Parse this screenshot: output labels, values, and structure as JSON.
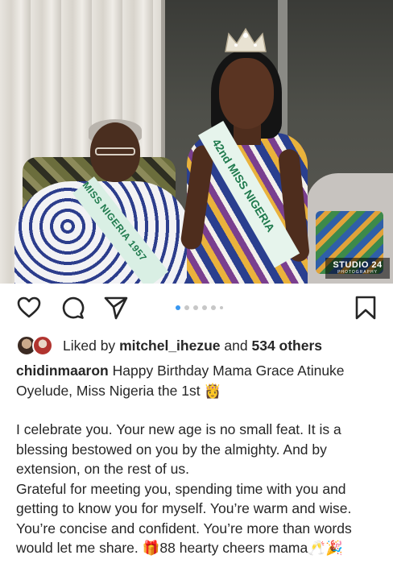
{
  "post": {
    "image_alt": "Two women wearing pageant sashes, one older seated woman and one young woman wearing a crown",
    "sash_left_text": "MISS NIGERIA 1957",
    "sash_right_text": "42nd MISS NIGERIA",
    "watermark": {
      "name": "STUDIO 24",
      "sub": "PHOTOGRAPHY"
    }
  },
  "actions": {
    "icons": [
      "heart-icon",
      "comment-icon",
      "share-icon",
      "bookmark-icon"
    ],
    "carousel": {
      "total_dots": 6,
      "active_index": 0
    }
  },
  "likes": {
    "prefix": "Liked by",
    "user": "mitchel_ihezue",
    "connector": "and",
    "others": "534 others"
  },
  "caption": {
    "username": "chidinmaaron",
    "line1": "Happy Birthday Mama Grace Atinuke Oyelude, Miss Nigeria the 1st 👸",
    "para2": "I celebrate you. Your new age is no small feat. It is a blessing bestowed on you by the almighty. And by extension, on the rest of us.",
    "para3": "Grateful for meeting you, spending time with you and getting to know you for myself. You’re warm and wise. You’re concise and confident. You’re more than words would let me share. 🎁88 hearty cheers mama🥂🎉"
  },
  "colors": {
    "text": "#262626",
    "active_dot": "#3897f0",
    "inactive_dot": "#c7c7c7",
    "sash_green": "#1f7a4d"
  }
}
